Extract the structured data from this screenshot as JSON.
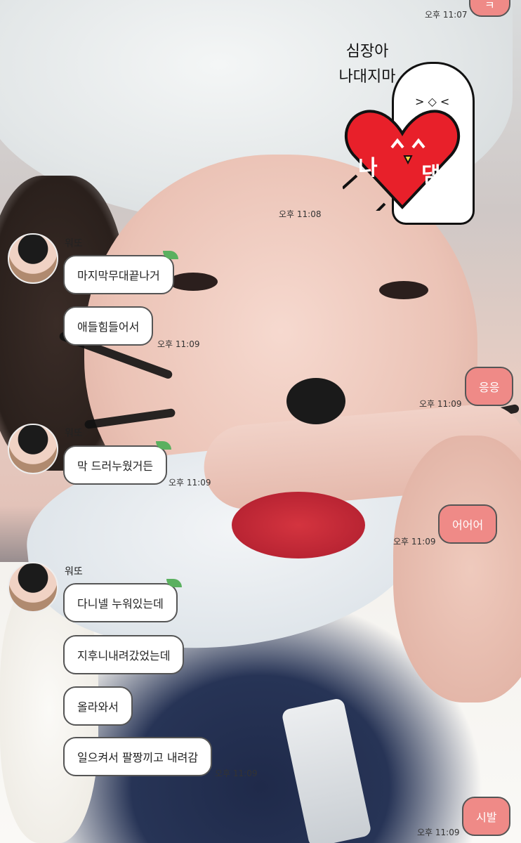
{
  "chat": {
    "sender_name": "워또",
    "sticker_text_line1": "심장아",
    "sticker_text_line2": "나대지마",
    "sticker_heart_left": "나",
    "sticker_heart_right": "댐",
    "messages_mine": [
      {
        "text": "ㅋ",
        "time": "오후 11:07"
      },
      {
        "text": "응응",
        "time": "오후 11:09"
      },
      {
        "text": "어어어",
        "time": "오후 11:09"
      },
      {
        "text": "시발",
        "time": "오후 11:09"
      }
    ],
    "sticker_time": "오후 11:08",
    "group1": {
      "messages": [
        "마지막무대끝나거",
        "애들힘들어서"
      ],
      "time": "오후 11:09"
    },
    "group2": {
      "messages": [
        "막 드러누웠거든"
      ],
      "time": "오후 11:09"
    },
    "group3": {
      "messages": [
        "다니넬 누워있는데",
        "지후니내려갔었는데",
        "올라와서",
        "일으켜서 팔짱끼고 내려감"
      ],
      "time": "오후 11:09"
    }
  },
  "colors": {
    "my_bubble": "#ef8a87",
    "their_bubble": "#ffffff",
    "leaf": "#5ab05f"
  },
  "icons": {
    "sticker": "heart-hug-sticker",
    "avatar": "profile-avatar"
  }
}
